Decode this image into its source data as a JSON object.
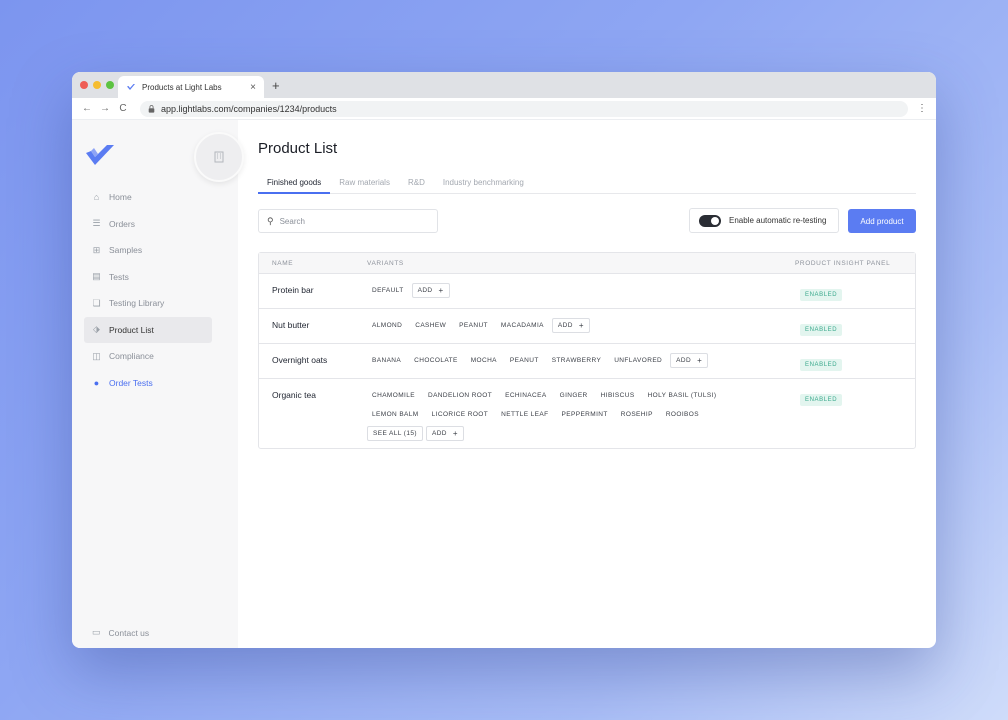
{
  "browser": {
    "tab_title": "Products at Light Labs",
    "new_tab": "+",
    "close_tab": "×",
    "url": "app.lightlabs.com/companies/1234/products",
    "back": "←",
    "forward": "→",
    "reload": "C",
    "menu": "⋮"
  },
  "sidebar": {
    "items": [
      {
        "label": "Home",
        "icon": "home-icon",
        "glyph": "⌂"
      },
      {
        "label": "Orders",
        "icon": "list-icon",
        "glyph": "☰"
      },
      {
        "label": "Samples",
        "icon": "grid-icon",
        "glyph": "⊞"
      },
      {
        "label": "Tests",
        "icon": "document-icon",
        "glyph": "▤"
      },
      {
        "label": "Testing Library",
        "icon": "library-icon",
        "glyph": "❏"
      },
      {
        "label": "Product List",
        "icon": "tag-icon",
        "glyph": "⬗"
      },
      {
        "label": "Compliance",
        "icon": "clipboard-icon",
        "glyph": "◫"
      },
      {
        "label": "Order Tests",
        "icon": "plus-circle-icon",
        "glyph": "●"
      }
    ],
    "contact": "Contact us"
  },
  "main": {
    "title": "Product List",
    "tabs": [
      "Finished goods",
      "Raw materials",
      "R&D",
      "Industry benchmarking"
    ],
    "search_placeholder": "Search",
    "toggle_label": "Enable automatic re-testing",
    "add_button": "Add product"
  },
  "table": {
    "headers": {
      "name": "NAME",
      "variants": "VARIANTS",
      "panel": "PRODUCT INSIGHT PANEL"
    },
    "rows": [
      {
        "name": "Protein bar",
        "variants": [
          "DEFAULT"
        ],
        "extra": [],
        "add": "ADD",
        "status": "ENABLED"
      },
      {
        "name": "Nut butter",
        "variants": [
          "ALMOND",
          "CASHEW",
          "PEANUT",
          "MACADAMIA"
        ],
        "extra": [],
        "add": "ADD",
        "status": "ENABLED"
      },
      {
        "name": "Overnight oats",
        "variants": [
          "BANANA",
          "CHOCOLATE",
          "MOCHA",
          "PEANUT",
          "STRAWBERRY",
          "UNFLAVORED"
        ],
        "extra": [],
        "add": "ADD",
        "status": "ENABLED"
      },
      {
        "name": "Organic tea",
        "variants": [
          "CHAMOMILE",
          "DANDELION ROOT",
          "ECHINACEA",
          "GINGER",
          "HIBISCUS",
          "HOLY BASIL (TULSI)",
          "LEMON BALM",
          "LICORICE ROOT",
          "NETTLE LEAF",
          "PEPPERMINT",
          "ROSEHIP",
          "ROOIBOS"
        ],
        "extra": [
          "SEE ALL (15)"
        ],
        "add": "ADD",
        "status": "ENABLED"
      }
    ]
  },
  "colors": {
    "accent": "#5b7cf2",
    "enabled": "#3aa98c"
  }
}
